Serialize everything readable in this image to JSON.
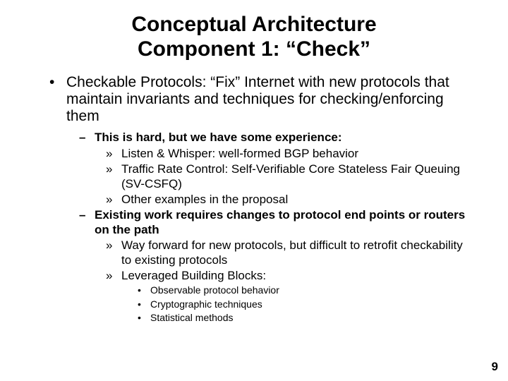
{
  "title_line1": "Conceptual Architecture",
  "title_line2": "Component 1: “Check”",
  "l1_1": "Checkable Protocols: “Fix” Internet with new protocols that maintain invariants and techniques for checking/enforcing them",
  "l2_1": "This is hard, but we have some experience:",
  "l3_1": "Listen & Whisper: well-formed BGP behavior",
  "l3_2": "Traffic Rate Control: Self-Verifiable Core Stateless Fair Queuing (SV-CSFQ)",
  "l3_3": "Other examples in the proposal",
  "l2_2": "Existing work requires changes to protocol end points or routers on the path",
  "l3_4": "Way forward for new protocols, but difficult to retrofit checkability to existing protocols",
  "l3_5": "Leveraged Building Blocks:",
  "l4_1": "Observable protocol behavior",
  "l4_2": "Cryptographic techniques",
  "l4_3": "Statistical methods",
  "page_number": "9"
}
